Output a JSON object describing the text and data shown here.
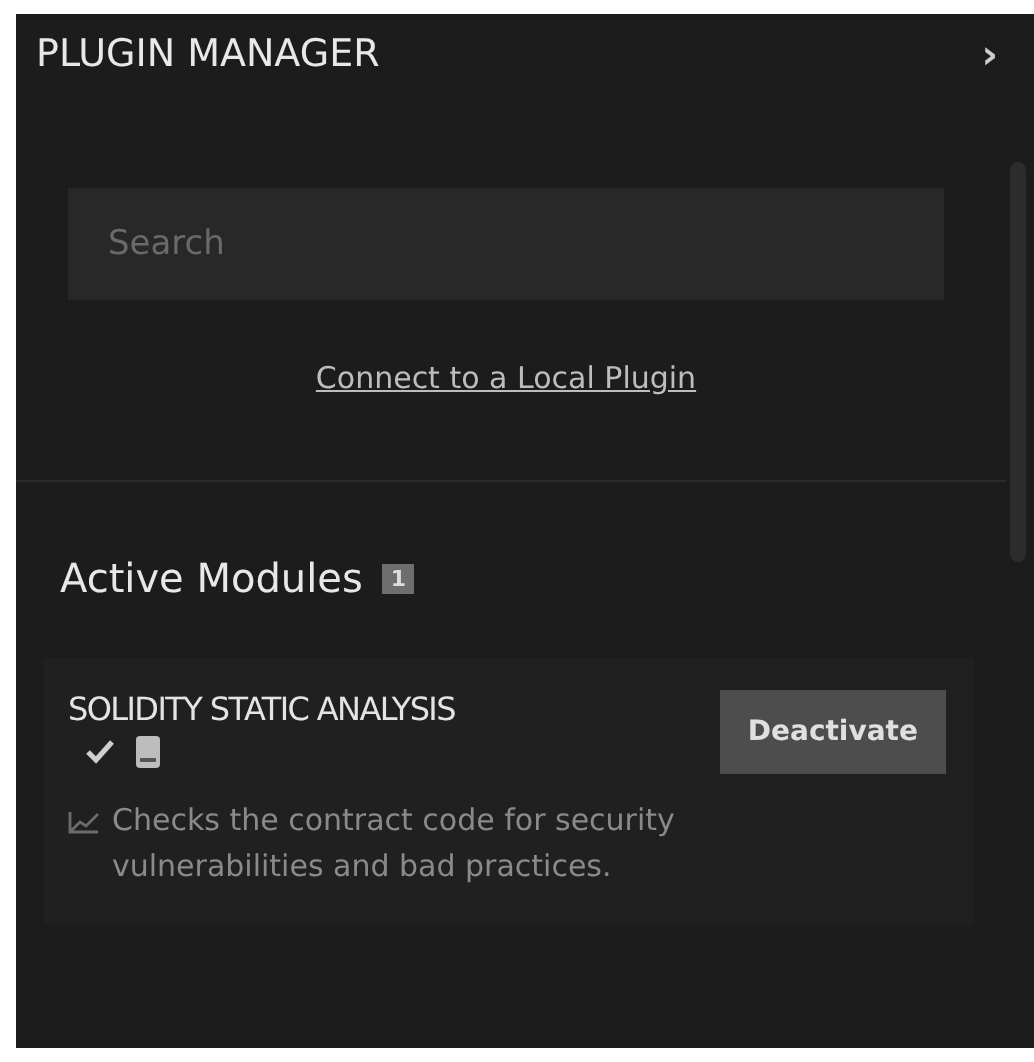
{
  "panel": {
    "title": "PLUGIN MANAGER",
    "toggle": "›"
  },
  "search": {
    "placeholder": "Search"
  },
  "link": "Connect to a Local Plugin",
  "section": {
    "title": "Active Modules",
    "count": "1"
  },
  "modules": [
    {
      "name": "SOLIDITY STATIC ANALYSIS",
      "verified": true,
      "button": "Deactivate",
      "description": "Checks the contract code for security vulnerabilities and bad practices."
    }
  ]
}
